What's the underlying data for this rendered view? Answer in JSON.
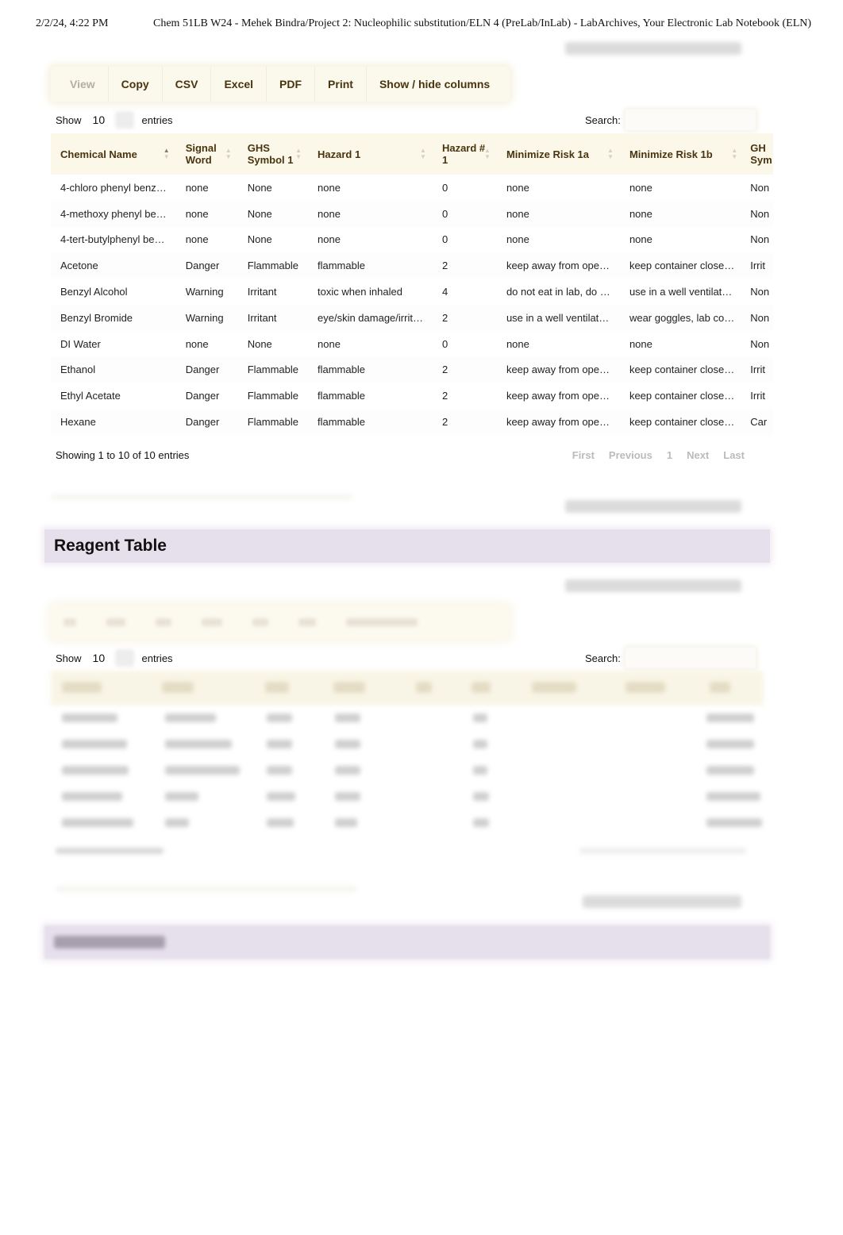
{
  "print_header": {
    "datetime": "2/2/24, 4:22 PM",
    "title": "Chem 51LB W24 - Mehek Bindra/Project 2: Nucleophilic substitution/ELN 4 (PreLab/InLab) - LabArchives, Your Electronic Lab Notebook (ELN)"
  },
  "safety_table": {
    "buttons": [
      {
        "label": "View",
        "disabled": true
      },
      {
        "label": "Copy",
        "disabled": false
      },
      {
        "label": "CSV",
        "disabled": false
      },
      {
        "label": "Excel",
        "disabled": false
      },
      {
        "label": "PDF",
        "disabled": false
      },
      {
        "label": "Print",
        "disabled": false
      },
      {
        "label": "Show / hide columns",
        "disabled": false
      }
    ],
    "length": {
      "prefix": "Show",
      "value": "10",
      "suffix": "entries"
    },
    "search": {
      "label": "Search:",
      "value": ""
    },
    "columns": [
      "Chemical Name",
      "Signal Word",
      "GHS Symbol 1",
      "Hazard 1",
      "Hazard # 1",
      "Minimize Risk 1a",
      "Minimize Risk 1b",
      "GH Sym"
    ],
    "sorted_column": "Chemical Name",
    "sort_direction": "ascending",
    "rows": [
      [
        "4-chloro phenyl benz…",
        "none",
        "None",
        "none",
        "0",
        "none",
        "none",
        "Non"
      ],
      [
        "4-methoxy phenyl be…",
        "none",
        "None",
        "none",
        "0",
        "none",
        "none",
        "Non"
      ],
      [
        "4-tert-butylphenyl be…",
        "none",
        "None",
        "none",
        "0",
        "none",
        "none",
        "Non"
      ],
      [
        "Acetone",
        "Danger",
        "Flammable",
        "flammable",
        "2",
        "keep away from ope…",
        "keep container close…",
        "Irrit"
      ],
      [
        "Benzyl Alcohol",
        "Warning",
        "Irritant",
        "toxic when inhaled",
        "4",
        "do not eat in lab, do …",
        "use in a well ventilat…",
        "Non"
      ],
      [
        "Benzyl Bromide",
        "Warning",
        "Irritant",
        "eye/skin damage/irrit…",
        "2",
        "use in a well ventilat…",
        "wear goggles, lab co…",
        "Non"
      ],
      [
        "DI Water",
        "none",
        "None",
        "none",
        "0",
        "none",
        "none",
        "Non"
      ],
      [
        "Ethanol",
        "Danger",
        "Flammable",
        "flammable",
        "2",
        "keep away from ope…",
        "keep container close…",
        "Irrit"
      ],
      [
        "Ethyl Acetate",
        "Danger",
        "Flammable",
        "flammable",
        "2",
        "keep away from ope…",
        "keep container close…",
        "Irrit"
      ],
      [
        "Hexane",
        "Danger",
        "Flammable",
        "flammable",
        "2",
        "keep away from ope…",
        "keep container close…",
        "Car"
      ]
    ],
    "info": "Showing 1 to 10 of 10 entries",
    "pagination": [
      "First",
      "Previous",
      "1",
      "Next",
      "Last"
    ]
  },
  "reagent_section": {
    "title": "Reagent Table",
    "length": {
      "prefix": "Show",
      "value": "10",
      "suffix": "entries"
    },
    "search": {
      "label": "Search:",
      "value": ""
    }
  },
  "colors": {
    "header_text": "#4a3410",
    "button_bar_bg": "#fbf8ec",
    "section_bar_bg": "#e6dfec",
    "disabled_text": "#b5aea4"
  }
}
